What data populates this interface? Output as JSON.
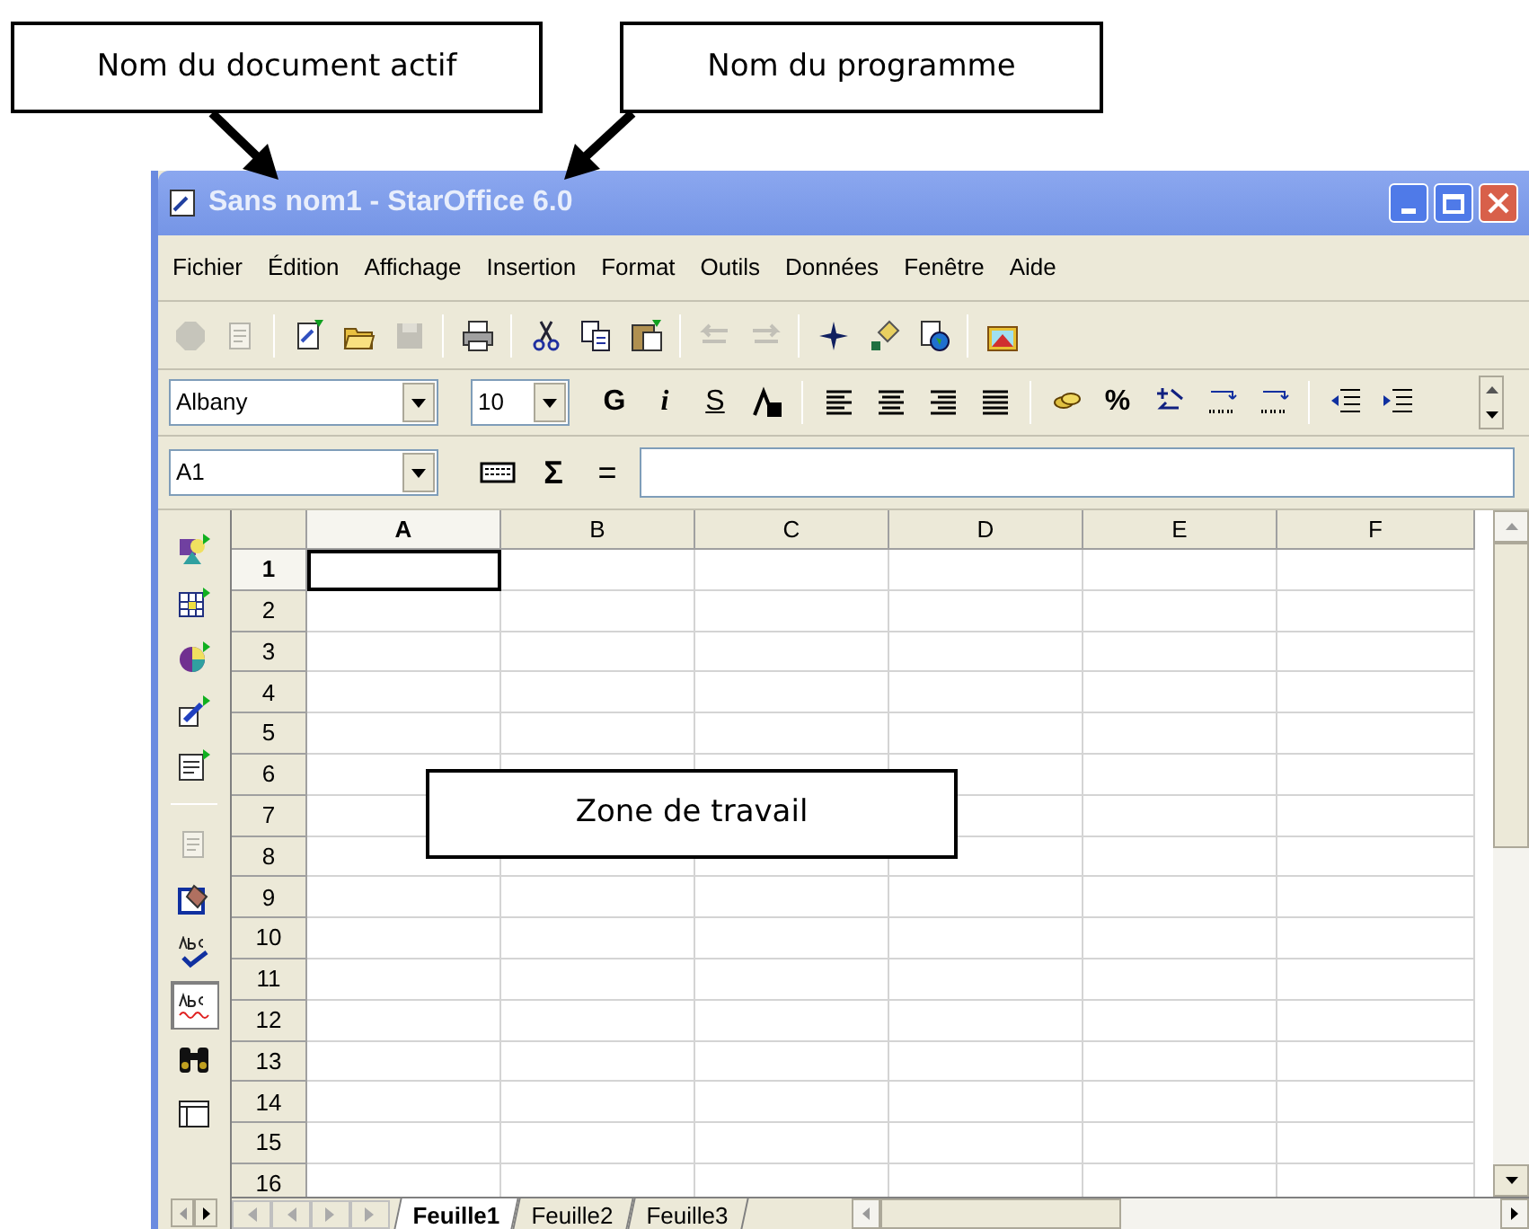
{
  "callouts": [
    {
      "text": "Nom du document actif"
    },
    {
      "text": "Nom du programme"
    }
  ],
  "work_zone_label": "Zone de travail",
  "window": {
    "title": "Sans nom1 - StarOffice 6.0"
  },
  "menu": [
    "Fichier",
    "Édition",
    "Affichage",
    "Insertion",
    "Format",
    "Outils",
    "Données",
    "Fenêtre",
    "Aide"
  ],
  "standard_toolbar": [
    {
      "kind": "stop",
      "disabled": true
    },
    {
      "kind": "edit",
      "disabled": true
    },
    {
      "kind": "sep"
    },
    {
      "kind": "new",
      "disabled": false
    },
    {
      "kind": "open",
      "disabled": false
    },
    {
      "kind": "save",
      "disabled": true
    },
    {
      "kind": "sep"
    },
    {
      "kind": "print",
      "disabled": false
    },
    {
      "kind": "sep"
    },
    {
      "kind": "cut",
      "disabled": false
    },
    {
      "kind": "copy",
      "disabled": false
    },
    {
      "kind": "paste",
      "disabled": false
    },
    {
      "kind": "sep"
    },
    {
      "kind": "undo",
      "disabled": true
    },
    {
      "kind": "redo",
      "disabled": true
    },
    {
      "kind": "sep"
    },
    {
      "kind": "navigator",
      "disabled": false
    },
    {
      "kind": "stylist",
      "disabled": false
    },
    {
      "kind": "web",
      "disabled": false
    },
    {
      "kind": "sep"
    },
    {
      "kind": "gallery",
      "disabled": false
    }
  ],
  "format_toolbar": {
    "font": "Albany",
    "size": "10",
    "buttons": [
      {
        "kind": "bold",
        "label": "G"
      },
      {
        "kind": "italic",
        "label": "i"
      },
      {
        "kind": "underline",
        "label": "S"
      },
      {
        "kind": "fontcolor"
      },
      {
        "kind": "sep"
      },
      {
        "kind": "align-left"
      },
      {
        "kind": "align-center"
      },
      {
        "kind": "align-right"
      },
      {
        "kind": "justify"
      },
      {
        "kind": "sep"
      },
      {
        "kind": "currency"
      },
      {
        "kind": "bold",
        "label": "%"
      },
      {
        "kind": "standard"
      },
      {
        "kind": "add-decimal"
      },
      {
        "kind": "del-decimal"
      },
      {
        "kind": "sep"
      },
      {
        "kind": "outdent"
      },
      {
        "kind": "indent"
      }
    ]
  },
  "formula_bar": {
    "cell_reference": "A1",
    "sum": "Σ",
    "equals": "="
  },
  "side_toolbar": [
    {
      "kind": "insert",
      "disabled": false,
      "pressed": false
    },
    {
      "kind": "cells",
      "disabled": false,
      "pressed": false
    },
    {
      "kind": "chart",
      "disabled": false,
      "pressed": false
    },
    {
      "kind": "draw",
      "disabled": false,
      "pressed": false
    },
    {
      "kind": "form",
      "disabled": false,
      "pressed": false
    },
    {
      "kind": "sep"
    },
    {
      "kind": "edit-file",
      "disabled": true,
      "pressed": false
    },
    {
      "kind": "autoformat",
      "disabled": false,
      "pressed": false
    },
    {
      "kind": "spellcheck",
      "disabled": false,
      "pressed": false
    },
    {
      "kind": "autospell",
      "disabled": false,
      "pressed": true
    },
    {
      "kind": "find",
      "disabled": false,
      "pressed": false
    },
    {
      "kind": "datasource",
      "disabled": false,
      "pressed": false
    }
  ],
  "columns": [
    {
      "label": "A",
      "selected": true
    },
    {
      "label": "B",
      "selected": false
    },
    {
      "label": "C",
      "selected": false
    },
    {
      "label": "D",
      "selected": false
    },
    {
      "label": "E",
      "selected": false
    },
    {
      "label": "F",
      "selected": false
    }
  ],
  "rows": [
    {
      "label": "1",
      "selected": true
    },
    {
      "label": "2",
      "selected": false
    },
    {
      "label": "3",
      "selected": false
    },
    {
      "label": "4",
      "selected": false
    },
    {
      "label": "5",
      "selected": false
    },
    {
      "label": "6",
      "selected": false
    },
    {
      "label": "7",
      "selected": false
    },
    {
      "label": "8",
      "selected": false
    },
    {
      "label": "9",
      "selected": false
    },
    {
      "label": "10",
      "selected": false
    },
    {
      "label": "11",
      "selected": false
    },
    {
      "label": "12",
      "selected": false
    },
    {
      "label": "13",
      "selected": false
    },
    {
      "label": "14",
      "selected": false
    },
    {
      "label": "15",
      "selected": false
    },
    {
      "label": "16",
      "selected": false
    }
  ],
  "sheet_tabs": [
    {
      "label": "Feuille1",
      "selected": true
    },
    {
      "label": "Feuille2",
      "selected": false
    },
    {
      "label": "Feuille3",
      "selected": false
    }
  ]
}
